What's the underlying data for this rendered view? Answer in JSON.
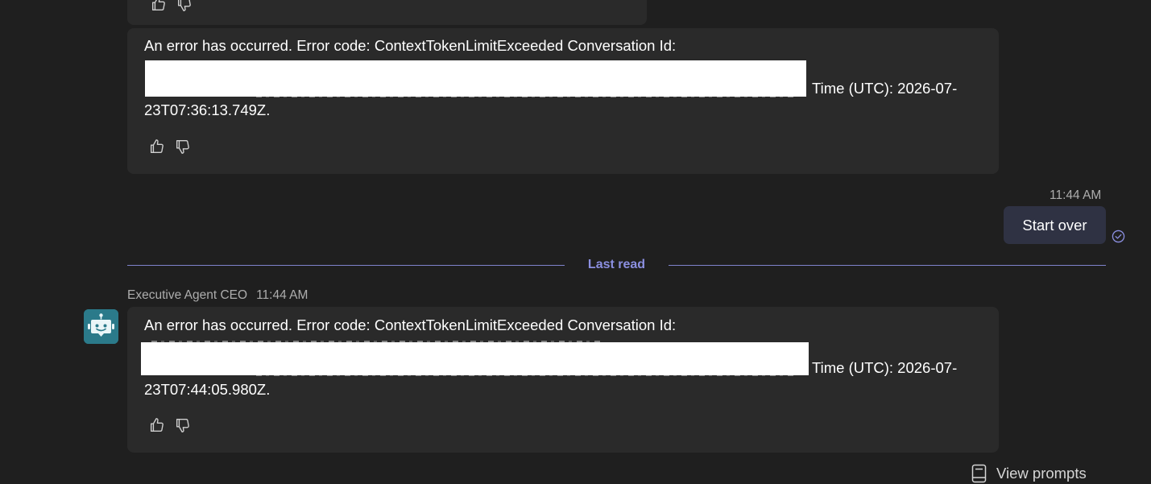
{
  "messages": [
    {
      "text_line1": "An error has occurred. Error code: ContextTokenLimitExceeded Conversation Id:",
      "text_line2_tail": "Time (UTC): 2026-07-",
      "text_line3": "23T07:36:13.749Z."
    },
    {
      "sender": "Executive Agent CEO",
      "time": "11:44 AM",
      "text_line1": "An error has occurred. Error code: ContextTokenLimitExceeded Conversation Id:",
      "text_line2_tail": "Time (UTC): 2026-07-",
      "text_line3": "23T07:44:05.980Z."
    }
  ],
  "user_message": {
    "time": "11:44 AM",
    "text": "Start over"
  },
  "divider": {
    "label": "Last read"
  },
  "footer": {
    "view_prompts_label": "View prompts"
  },
  "colors": {
    "background": "#1f1f1f",
    "bubble": "#2a2a2a",
    "user_bubble": "#2f3243",
    "accent": "#8b8fe0",
    "avatar": "#2b7a8a"
  },
  "icons": {
    "like": "thumbs-up-icon",
    "dislike": "thumbs-down-icon",
    "read": "read-receipt-icon",
    "avatar": "bot-avatar-icon",
    "prompts": "prompt-book-icon"
  }
}
